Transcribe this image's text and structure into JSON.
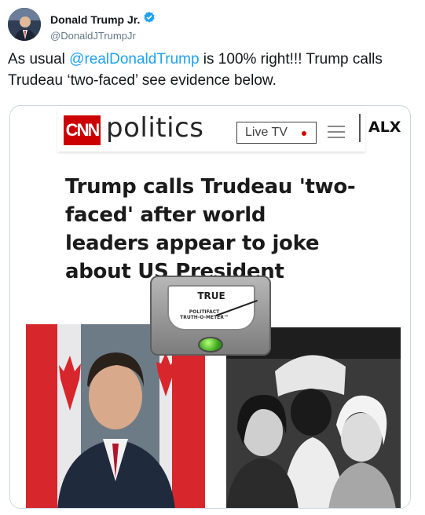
{
  "tweet": {
    "display_name": "Donald Trump Jr.",
    "handle": "@DonaldJTrumpJr",
    "text_before": "As usual ",
    "mention": "@realDonaldTrump",
    "text_after": " is 100% right!!! Trump calls Trudeau ‘two-faced’ see evidence below.",
    "verified": true
  },
  "media": {
    "cnn_logo": "CNN",
    "section": "politics",
    "live_tv": "Live TV",
    "alx": "ALX",
    "headline": "Trump calls Trudeau 'two-faced' after world leaders appear to joke about US President",
    "meter_rating": "TRUE",
    "meter_caption_line1": "POLITIFACT",
    "meter_caption_line2": "TRUTH-O-METER™"
  },
  "colors": {
    "mention": "#1da1f2",
    "verified_badge": "#1da1f2",
    "cnn_red": "#cc0000"
  },
  "icons": {
    "verified": "verified-badge-icon",
    "menu": "hamburger-menu-icon"
  }
}
